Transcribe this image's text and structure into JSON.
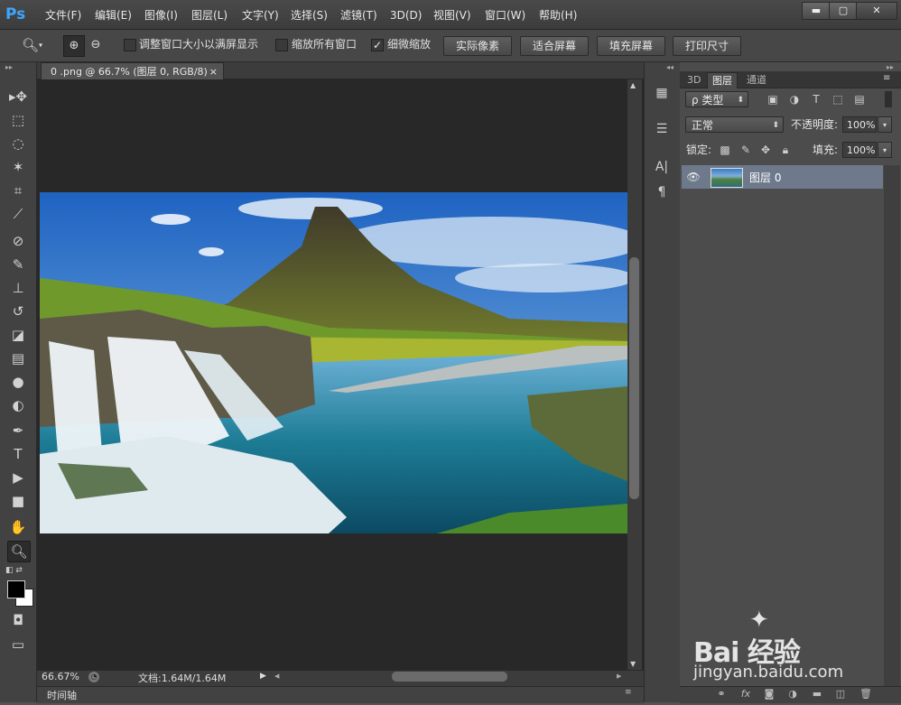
{
  "app": {
    "logo": "Ps",
    "accent": "#3da6ff"
  },
  "menu": [
    "文件(F)",
    "编辑(E)",
    "图像(I)",
    "图层(L)",
    "文字(Y)",
    "选择(S)",
    "滤镜(T)",
    "3D(D)",
    "视图(V)",
    "窗口(W)",
    "帮助(H)"
  ],
  "window_controls": {
    "minimize": "▬",
    "maximize": "▢",
    "close": "✕"
  },
  "options": {
    "fit_window_label": "调整窗口大小以满屏显示",
    "zoom_all_label": "缩放所有窗口",
    "scrubby_label": "细微缩放",
    "scrubby_checked": true,
    "actual_pixels": "实际像素",
    "fit_screen": "适合屏幕",
    "fill_screen": "填充屏幕",
    "print_size": "打印尺寸"
  },
  "document": {
    "tab_title": "0 .png @ 66.7% (图层 0, RGB/8)",
    "tab_close": "×",
    "zoom": "66.67%",
    "doc_info": "文档:1.64M/1.64M"
  },
  "timeline": {
    "label": "时间轴"
  },
  "panel": {
    "tabs": [
      "3D",
      "图层",
      "通道"
    ],
    "filter_kind": "ρ 类型",
    "blend_mode": "正常",
    "opacity_label": "不透明度:",
    "opacity_value": "100%",
    "lock_label": "锁定:",
    "fill_label": "填充:",
    "fill_value": "100%",
    "layers": [
      {
        "name": "图层 0",
        "visible": true
      }
    ]
  },
  "watermark": {
    "brand": "Bai 经验",
    "url": "jingyan.baidu.com"
  }
}
